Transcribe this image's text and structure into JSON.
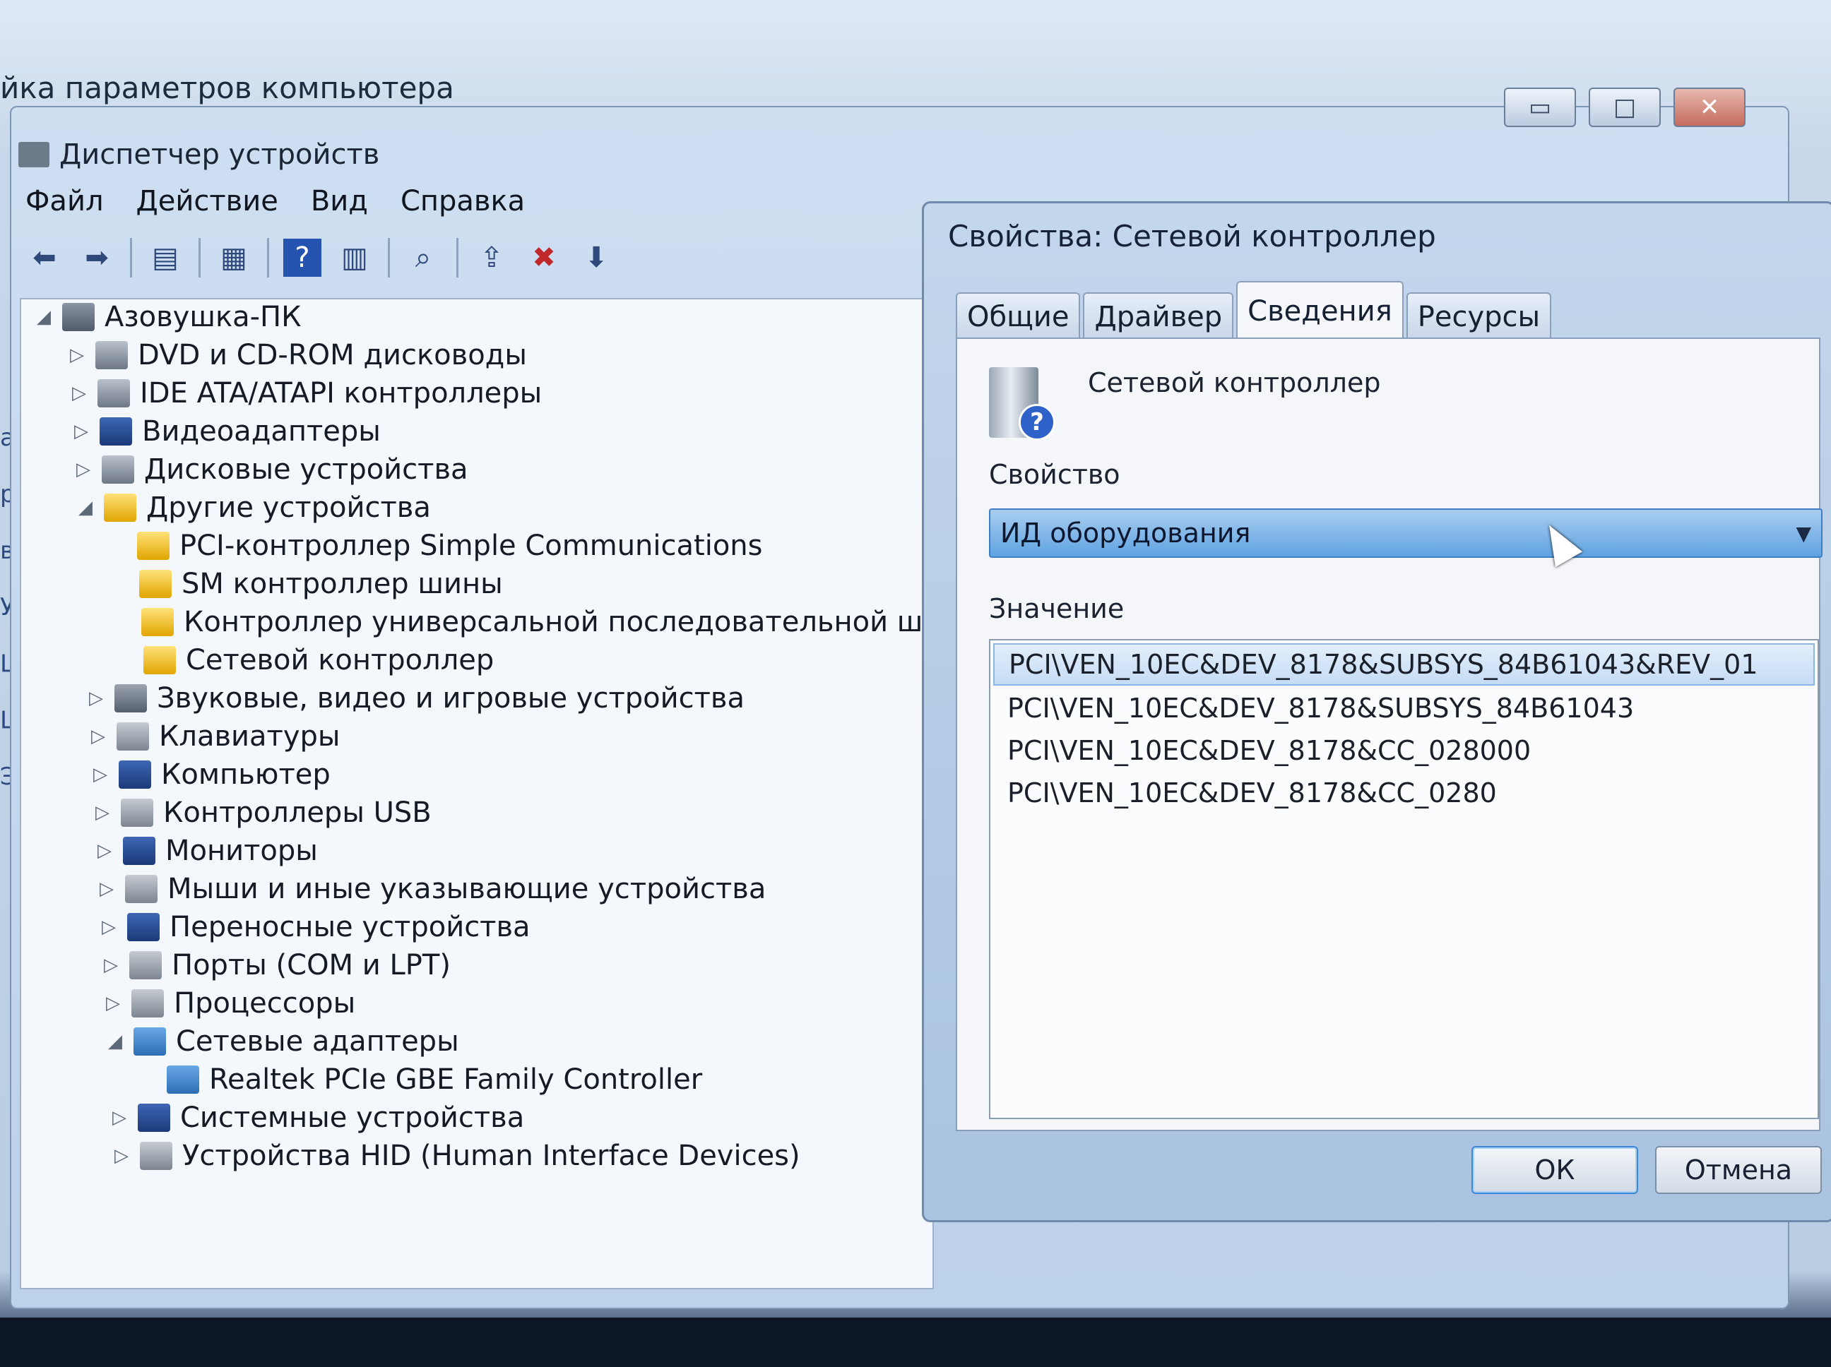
{
  "background": {
    "title": "йка параметров компьютера",
    "side_letters": [
      "а",
      "р",
      "ва",
      "Уп",
      "Це",
      "Це",
      "Эл"
    ]
  },
  "device_manager": {
    "title": "Диспетчер устройств",
    "window_buttons": {
      "minimize": "▭",
      "maximize": "□",
      "close": "✕"
    },
    "menu": [
      "Файл",
      "Действие",
      "Вид",
      "Справка"
    ],
    "tree": [
      {
        "label": "Азовушка-ПК",
        "level": 0,
        "arrow": "◢",
        "icon": "pc"
      },
      {
        "label": "DVD и CD-ROM дисководы",
        "level": 1,
        "arrow": "▷",
        "icon": "drive"
      },
      {
        "label": "IDE ATA/ATAPI контроллеры",
        "level": 1,
        "arrow": "▷",
        "icon": "drive"
      },
      {
        "label": "Видеоадаптеры",
        "level": 1,
        "arrow": "▷",
        "icon": "monitor"
      },
      {
        "label": "Дисковые устройства",
        "level": 1,
        "arrow": "▷",
        "icon": "drive"
      },
      {
        "label": "Другие устройства",
        "level": 1,
        "arrow": "◢",
        "icon": "warn"
      },
      {
        "label": "PCI-контроллер Simple Communications",
        "level": 2,
        "arrow": "",
        "icon": "warn"
      },
      {
        "label": "SM контроллер шины",
        "level": 2,
        "arrow": "",
        "icon": "warn"
      },
      {
        "label": "Контроллер универсальной последовательной шины USB",
        "level": 2,
        "arrow": "",
        "icon": "warn"
      },
      {
        "label": "Сетевой контроллер",
        "level": 2,
        "arrow": "",
        "icon": "warn"
      },
      {
        "label": "Звуковые, видео и игровые устройства",
        "level": 1,
        "arrow": "▷",
        "icon": "audio"
      },
      {
        "label": "Клавиатуры",
        "level": 1,
        "arrow": "▷",
        "icon": "gray"
      },
      {
        "label": "Компьютер",
        "level": 1,
        "arrow": "▷",
        "icon": "monitor"
      },
      {
        "label": "Контроллеры USB",
        "level": 1,
        "arrow": "▷",
        "icon": "gray"
      },
      {
        "label": "Мониторы",
        "level": 1,
        "arrow": "▷",
        "icon": "monitor"
      },
      {
        "label": "Мыши и иные указывающие устройства",
        "level": 1,
        "arrow": "▷",
        "icon": "gray"
      },
      {
        "label": "Переносные устройства",
        "level": 1,
        "arrow": "▷",
        "icon": "monitor"
      },
      {
        "label": "Порты (COM и LPT)",
        "level": 1,
        "arrow": "▷",
        "icon": "gray"
      },
      {
        "label": "Процессоры",
        "level": 1,
        "arrow": "▷",
        "icon": "gray"
      },
      {
        "label": "Сетевые адаптеры",
        "level": 1,
        "arrow": "◢",
        "icon": "net"
      },
      {
        "label": "Realtek PCIe GBE Family Controller",
        "level": 2,
        "arrow": "",
        "icon": "net"
      },
      {
        "label": "Системные устройства",
        "level": 1,
        "arrow": "▷",
        "icon": "monitor"
      },
      {
        "label": "Устройства HID (Human Interface Devices)",
        "level": 1,
        "arrow": "▷",
        "icon": "gray"
      }
    ]
  },
  "dialog": {
    "title": "Свойства: Сетевой контроллер",
    "tabs": [
      "Общие",
      "Драйвер",
      "Сведения",
      "Ресурсы"
    ],
    "active_tab": "Сведения",
    "device_name": "Сетевой контроллер",
    "property_label": "Свойство",
    "property_value": "ИД оборудования",
    "value_label": "Значение",
    "values": [
      "PCI\\VEN_10EC&DEV_8178&SUBSYS_84B61043&REV_01",
      "PCI\\VEN_10EC&DEV_8178&SUBSYS_84B61043",
      "PCI\\VEN_10EC&DEV_8178&CC_028000",
      "PCI\\VEN_10EC&DEV_8178&CC_0280"
    ],
    "ok_label": "ОК",
    "cancel_label": "Отмена"
  }
}
